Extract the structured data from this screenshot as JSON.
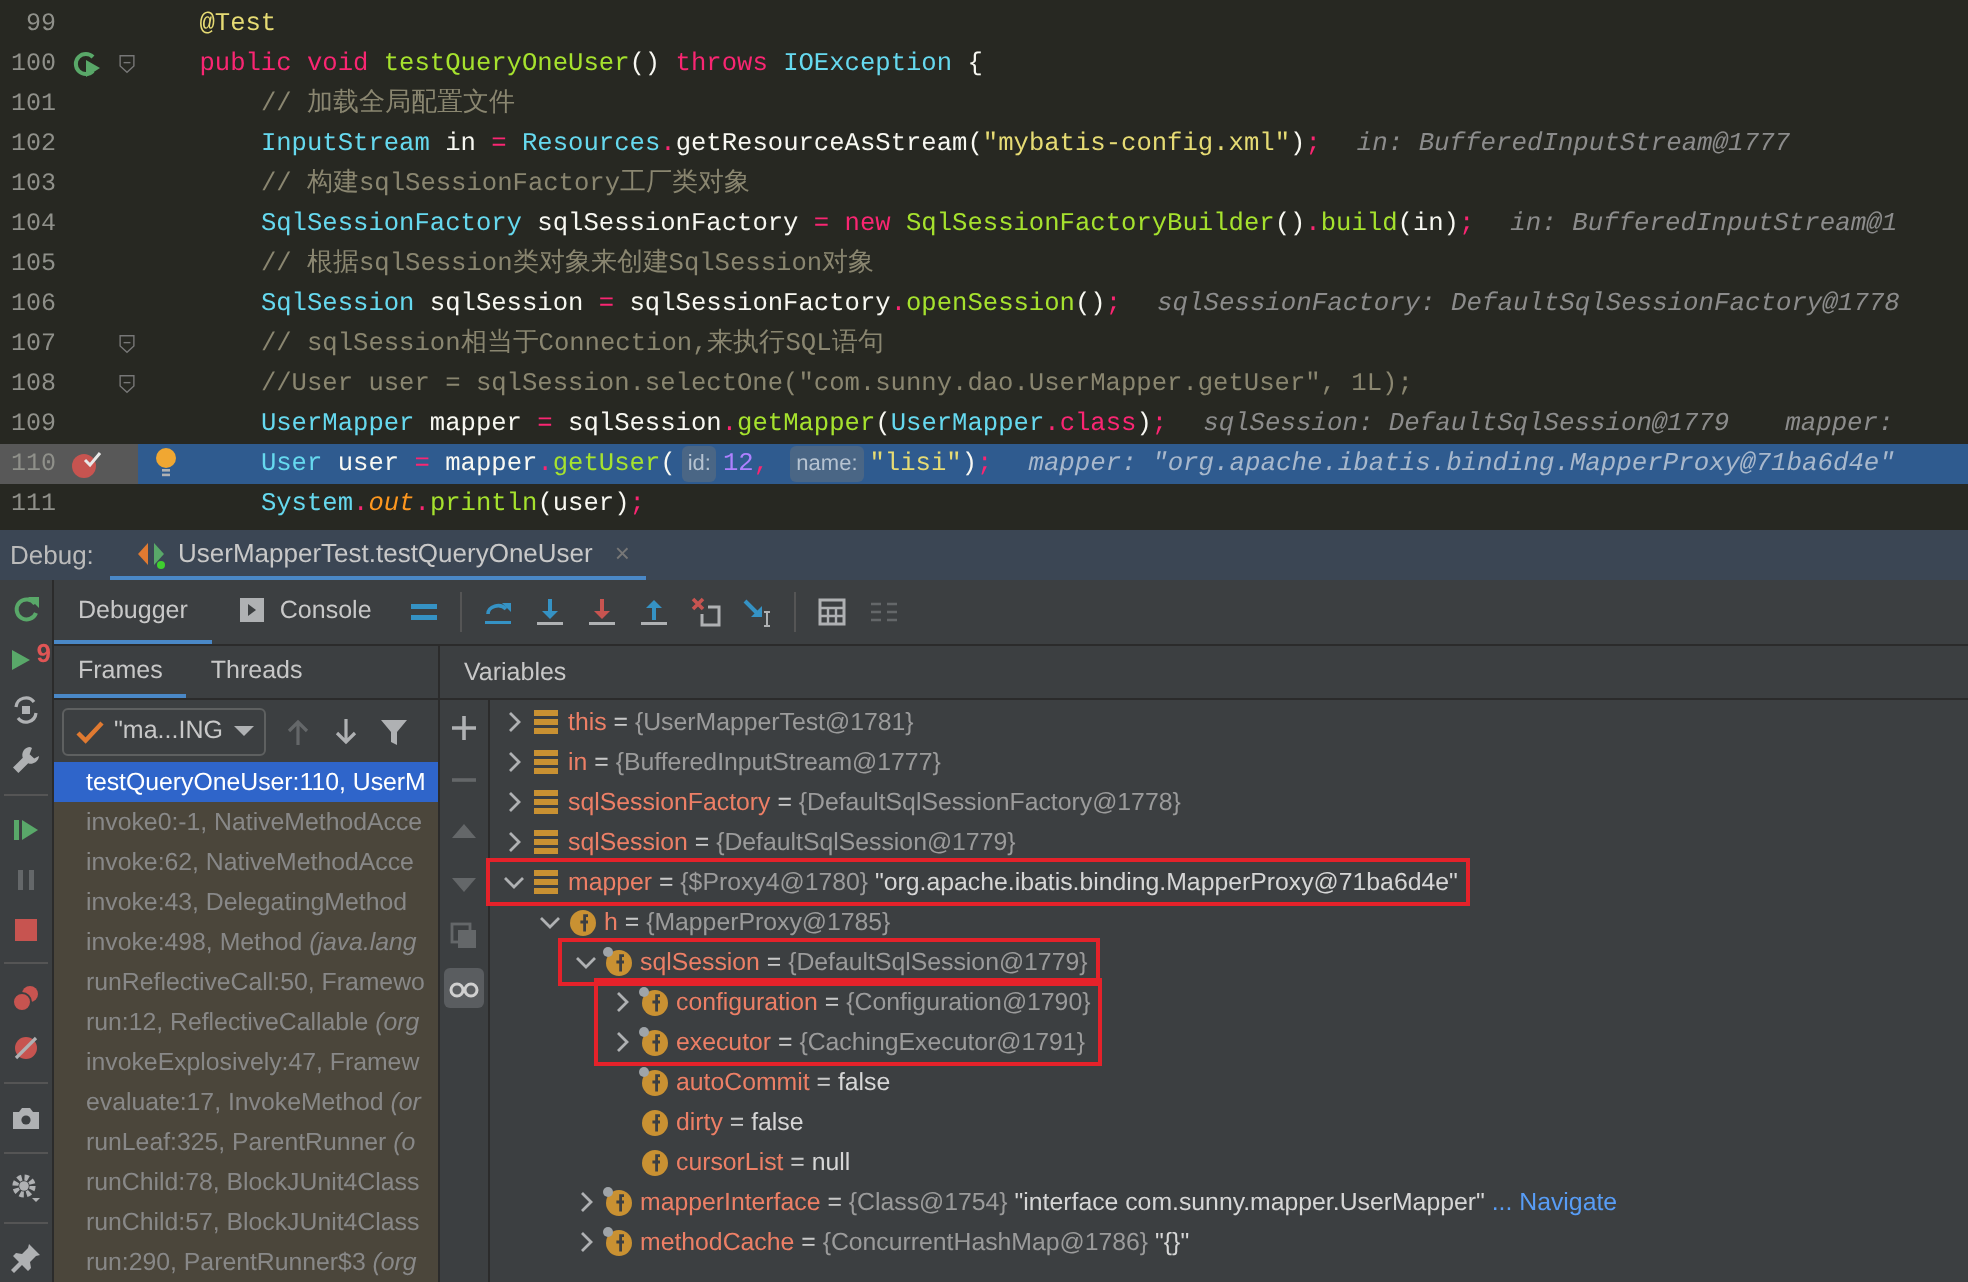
{
  "editor": {
    "lines": [
      {
        "num": "99",
        "current": false,
        "fold": false,
        "runnable": false,
        "breakpoint": false,
        "bulb": false,
        "tokens": [
          {
            "kind": "ann",
            "text": "    @Test"
          }
        ]
      },
      {
        "num": "100",
        "current": false,
        "fold": true,
        "runnable": true,
        "breakpoint": false,
        "bulb": false,
        "tokens": [
          {
            "kind": "kw",
            "text": "    public void "
          },
          {
            "kind": "fn",
            "text": "testQueryOneUser"
          },
          {
            "kind": "plain",
            "text": "() "
          },
          {
            "kind": "kw",
            "text": "throws "
          },
          {
            "kind": "type",
            "text": "IOException"
          },
          {
            "kind": "plain",
            "text": " {"
          }
        ]
      },
      {
        "num": "101",
        "current": false,
        "fold": false,
        "runnable": false,
        "breakpoint": false,
        "bulb": false,
        "tokens": [
          {
            "kind": "cm",
            "text": "        // 加载全局配置文件"
          }
        ]
      },
      {
        "num": "102",
        "current": false,
        "fold": false,
        "runnable": false,
        "breakpoint": false,
        "bulb": false,
        "tokens": [
          {
            "kind": "type",
            "text": "        InputStream"
          },
          {
            "kind": "plain",
            "text": " in "
          },
          {
            "kind": "op",
            "text": "="
          },
          {
            "kind": "type",
            "text": " Resources"
          },
          {
            "kind": "op",
            "text": "."
          },
          {
            "kind": "plain",
            "text": "getResourceAsStream("
          },
          {
            "kind": "str",
            "text": "\"mybatis-config.xml\""
          },
          {
            "kind": "plain",
            "text": ")"
          },
          {
            "kind": "op",
            "text": ";"
          }
        ],
        "hints": [
          "in: BufferedInputStream@1777"
        ]
      },
      {
        "num": "103",
        "current": false,
        "fold": false,
        "runnable": false,
        "breakpoint": false,
        "bulb": false,
        "tokens": [
          {
            "kind": "cm",
            "text": "        // 构建sqlSessionFactory工厂类对象"
          }
        ]
      },
      {
        "num": "104",
        "current": false,
        "fold": false,
        "runnable": false,
        "breakpoint": false,
        "bulb": false,
        "tokens": [
          {
            "kind": "type",
            "text": "        SqlSessionFactory"
          },
          {
            "kind": "plain",
            "text": " sqlSessionFactory "
          },
          {
            "kind": "op",
            "text": "= "
          },
          {
            "kind": "kw",
            "text": "new "
          },
          {
            "kind": "fn",
            "text": "SqlSessionFactoryBuilder"
          },
          {
            "kind": "plain",
            "text": "()"
          },
          {
            "kind": "op",
            "text": "."
          },
          {
            "kind": "fn",
            "text": "build"
          },
          {
            "kind": "plain",
            "text": "(in)"
          },
          {
            "kind": "op",
            "text": ";"
          }
        ],
        "hints": [
          "in: BufferedInputStream@1"
        ]
      },
      {
        "num": "105",
        "current": false,
        "fold": false,
        "runnable": false,
        "breakpoint": false,
        "bulb": false,
        "tokens": [
          {
            "kind": "cm",
            "text": "        // 根据sqlSession类对象来创建SqlSession对象"
          }
        ]
      },
      {
        "num": "106",
        "current": false,
        "fold": false,
        "runnable": false,
        "breakpoint": false,
        "bulb": false,
        "tokens": [
          {
            "kind": "type",
            "text": "        SqlSession"
          },
          {
            "kind": "plain",
            "text": " sqlSession "
          },
          {
            "kind": "op",
            "text": "="
          },
          {
            "kind": "plain",
            "text": " sqlSessionFactory"
          },
          {
            "kind": "op",
            "text": "."
          },
          {
            "kind": "fn",
            "text": "openSession"
          },
          {
            "kind": "plain",
            "text": "()"
          },
          {
            "kind": "op",
            "text": ";"
          }
        ],
        "hints": [
          "sqlSessionFactory: DefaultSqlSessionFactory@1778"
        ]
      },
      {
        "num": "107",
        "current": false,
        "fold": true,
        "runnable": false,
        "breakpoint": false,
        "bulb": false,
        "tokens": [
          {
            "kind": "cm",
            "text": "        // sqlSession相当于Connection,来执行SQL语句"
          }
        ]
      },
      {
        "num": "108",
        "current": false,
        "fold": true,
        "runnable": false,
        "breakpoint": false,
        "bulb": false,
        "tokens": [
          {
            "kind": "cm",
            "text": "        //User user = sqlSession.selectOne(\"com.sunny.dao.UserMapper.getUser\", 1L);"
          }
        ]
      },
      {
        "num": "109",
        "current": false,
        "fold": false,
        "runnable": false,
        "breakpoint": false,
        "bulb": false,
        "tokens": [
          {
            "kind": "type",
            "text": "        UserMapper"
          },
          {
            "kind": "plain",
            "text": " mapper "
          },
          {
            "kind": "op",
            "text": "="
          },
          {
            "kind": "plain",
            "text": " sqlSession"
          },
          {
            "kind": "op",
            "text": "."
          },
          {
            "kind": "fn",
            "text": "getMapper"
          },
          {
            "kind": "plain",
            "text": "("
          },
          {
            "kind": "type",
            "text": "UserMapper"
          },
          {
            "kind": "op",
            "text": ".class"
          },
          {
            "kind": "plain",
            "text": ")"
          },
          {
            "kind": "op",
            "text": ";"
          }
        ],
        "hints": [
          "sqlSession: DefaultSqlSession@1779",
          "mapper:"
        ]
      },
      {
        "num": "110",
        "current": true,
        "fold": false,
        "runnable": false,
        "breakpoint": true,
        "bulb": true,
        "tokens": [
          {
            "kind": "type",
            "text": "        User"
          },
          {
            "kind": "plain",
            "text": " user "
          },
          {
            "kind": "op",
            "text": "="
          },
          {
            "kind": "plain",
            "text": " mapper"
          },
          {
            "kind": "op",
            "text": "."
          },
          {
            "kind": "fn",
            "text": "getUser"
          },
          {
            "kind": "plain",
            "text": "("
          },
          {
            "kind": "inlay",
            "text": "id:"
          },
          {
            "kind": "num",
            "text": "12"
          },
          {
            "kind": "op",
            "text": ", "
          },
          {
            "kind": "inlay",
            "text": "name:"
          },
          {
            "kind": "str",
            "text": "\"lisi\""
          },
          {
            "kind": "plain",
            "text": ")"
          },
          {
            "kind": "op",
            "text": ";"
          }
        ],
        "hints": [
          "mapper: \"org.apache.ibatis.binding.MapperProxy@71ba6d4e\""
        ]
      },
      {
        "num": "111",
        "current": false,
        "fold": false,
        "runnable": false,
        "breakpoint": false,
        "bulb": false,
        "tokens": [
          {
            "kind": "type",
            "text": "        System"
          },
          {
            "kind": "op",
            "text": "."
          },
          {
            "kind": "field",
            "text": "out"
          },
          {
            "kind": "op",
            "text": "."
          },
          {
            "kind": "fn",
            "text": "println"
          },
          {
            "kind": "plain",
            "text": "(user)"
          },
          {
            "kind": "op",
            "text": ";"
          }
        ]
      }
    ]
  },
  "debug": {
    "label": "Debug:",
    "session_tab": {
      "title": "UserMapperTest.testQueryOneUser",
      "close": "×",
      "selected": true
    },
    "side_tools": [
      {
        "kind": "rerun",
        "disabled": false
      },
      {
        "kind": "rerunf",
        "badge": "9",
        "disabled": false
      },
      {
        "kind": "restore",
        "disabled": false
      },
      {
        "kind": "wrench",
        "disabled": false
      },
      {
        "kind": "separator"
      },
      {
        "kind": "resume",
        "disabled": false
      },
      {
        "kind": "pause",
        "disabled": true
      },
      {
        "kind": "stop",
        "disabled": false
      },
      {
        "kind": "separator"
      },
      {
        "kind": "bps",
        "disabled": false
      },
      {
        "kind": "mute",
        "disabled": false
      },
      {
        "kind": "separator"
      },
      {
        "kind": "camera",
        "disabled": false
      },
      {
        "kind": "separator"
      },
      {
        "kind": "gear",
        "disabled": false
      },
      {
        "kind": "separator"
      },
      {
        "kind": "pin",
        "disabled": false
      }
    ],
    "tabs": [
      {
        "kind": "plain",
        "label": "Debugger",
        "selected": true
      },
      {
        "kind": "console",
        "label": "Console",
        "selected": false
      }
    ],
    "toolbar": [
      {
        "kind": "lines",
        "disabled": false
      },
      {
        "kind": "separator"
      },
      {
        "kind": "stepover",
        "disabled": false
      },
      {
        "kind": "stepinto",
        "disabled": false
      },
      {
        "kind": "forcestep",
        "disabled": false
      },
      {
        "kind": "stepout",
        "disabled": false
      },
      {
        "kind": "dropframe",
        "disabled": false
      },
      {
        "kind": "runcursor",
        "disabled": false
      },
      {
        "kind": "separator"
      },
      {
        "kind": "calc",
        "disabled": false
      },
      {
        "kind": "trace",
        "disabled": true
      }
    ],
    "frame_tabs": [
      {
        "label": "Frames",
        "selected": true
      },
      {
        "label": "Threads",
        "selected": false
      }
    ],
    "variables_title": "Variables",
    "thread_picker": {
      "value": "\"ma...ING"
    },
    "frame_nav": [
      {
        "kind": "up",
        "disabled": true
      },
      {
        "kind": "down",
        "disabled": false
      },
      {
        "kind": "filter",
        "disabled": false
      }
    ],
    "frames": [
      {
        "text": "testQueryOneUser:110, UserM",
        "selected": true
      },
      {
        "text": "invoke0:-1, NativeMethodAcce",
        "selected": false
      },
      {
        "text": "invoke:62, NativeMethodAcce",
        "selected": false
      },
      {
        "text": "invoke:43, DelegatingMethod",
        "selected": false
      },
      {
        "text": "invoke:498, Method *(java.lang*",
        "selected": false
      },
      {
        "text": "runReflectiveCall:50, Framewo",
        "selected": false
      },
      {
        "text": "run:12, ReflectiveCallable *(org*",
        "selected": false
      },
      {
        "text": "invokeExplosively:47, Framew",
        "selected": false
      },
      {
        "text": "evaluate:17, InvokeMethod *(or*",
        "selected": false
      },
      {
        "text": "runLeaf:325, ParentRunner *(o*",
        "selected": false
      },
      {
        "text": "runChild:78, BlockJUnit4Class",
        "selected": false
      },
      {
        "text": "runChild:57, BlockJUnit4Class",
        "selected": false
      },
      {
        "text": "run:290, ParentRunner$3 *(org*",
        "selected": false
      }
    ],
    "var_tools": [
      {
        "kind": "plus",
        "disabled": false,
        "selected": false
      },
      {
        "kind": "minus",
        "disabled": true,
        "selected": false
      },
      {
        "kind": "triup",
        "disabled": true,
        "selected": false
      },
      {
        "kind": "tridown",
        "disabled": true,
        "selected": false
      },
      {
        "kind": "copy",
        "disabled": true,
        "selected": false
      },
      {
        "kind": "glasses",
        "disabled": false,
        "selected": true
      }
    ],
    "variables": [
      {
        "kind": "local",
        "name": "this",
        "sep": "=",
        "ref": "{UserMapperTest@1781}",
        "expanded": false,
        "boxed": false
      },
      {
        "kind": "local",
        "name": "in",
        "sep": "=",
        "ref": "{BufferedInputStream@1777}",
        "expanded": false,
        "boxed": false
      },
      {
        "kind": "local",
        "name": "sqlSessionFactory",
        "sep": "=",
        "ref": "{DefaultSqlSessionFactory@1778}",
        "expanded": false,
        "boxed": false
      },
      {
        "kind": "local",
        "name": "sqlSession",
        "sep": "=",
        "ref": "{DefaultSqlSession@1779}",
        "expanded": false,
        "boxed": false
      },
      {
        "kind": "local",
        "name": "mapper",
        "sep": "=",
        "ref": "{$Proxy4@1780}",
        "value": "\"org.apache.ibatis.binding.MapperProxy@71ba6d4e\"",
        "expanded": true,
        "boxed": true,
        "children": [
          {
            "kind": "field",
            "final": false,
            "name": "h",
            "sep": "=",
            "ref": "{MapperProxy@1785}",
            "expanded": true,
            "boxed": false,
            "children": [
              {
                "kind": "field",
                "final": true,
                "name": "sqlSession",
                "sep": "=",
                "ref": "{DefaultSqlSession@1779}",
                "expanded": true,
                "boxed": true,
                "children": [
                  {
                    "kind": "field",
                    "final": true,
                    "name": "configuration",
                    "sep": "=",
                    "ref": "{Configuration@1790}",
                    "expanded": false,
                    "boxed": true
                  },
                  {
                    "kind": "field",
                    "final": true,
                    "name": "executor",
                    "sep": "=",
                    "ref": "{CachingExecutor@1791}",
                    "expanded": false,
                    "boxed": true
                  },
                  {
                    "kind": "field",
                    "final": true,
                    "name": "autoCommit",
                    "sep": "=",
                    "value": "false",
                    "boxed": false
                  },
                  {
                    "kind": "field",
                    "final": false,
                    "name": "dirty",
                    "sep": "=",
                    "value": "false",
                    "boxed": false
                  },
                  {
                    "kind": "field",
                    "final": false,
                    "name": "cursorList",
                    "sep": "=",
                    "value": "null",
                    "boxed": false
                  }
                ]
              },
              {
                "kind": "field",
                "final": true,
                "name": "mapperInterface",
                "sep": "=",
                "ref": "{Class@1754}",
                "value": "\"interface com.sunny.mapper.UserMapper\"",
                "more": "...",
                "link": "Navigate",
                "expanded": false,
                "boxed": false
              },
              {
                "kind": "field",
                "final": true,
                "name": "methodCache",
                "sep": "=",
                "ref": "{ConcurrentHashMap@1786}",
                "value": "\"{}\"",
                "expanded": false,
                "boxed": false
              }
            ]
          }
        ]
      }
    ]
  }
}
